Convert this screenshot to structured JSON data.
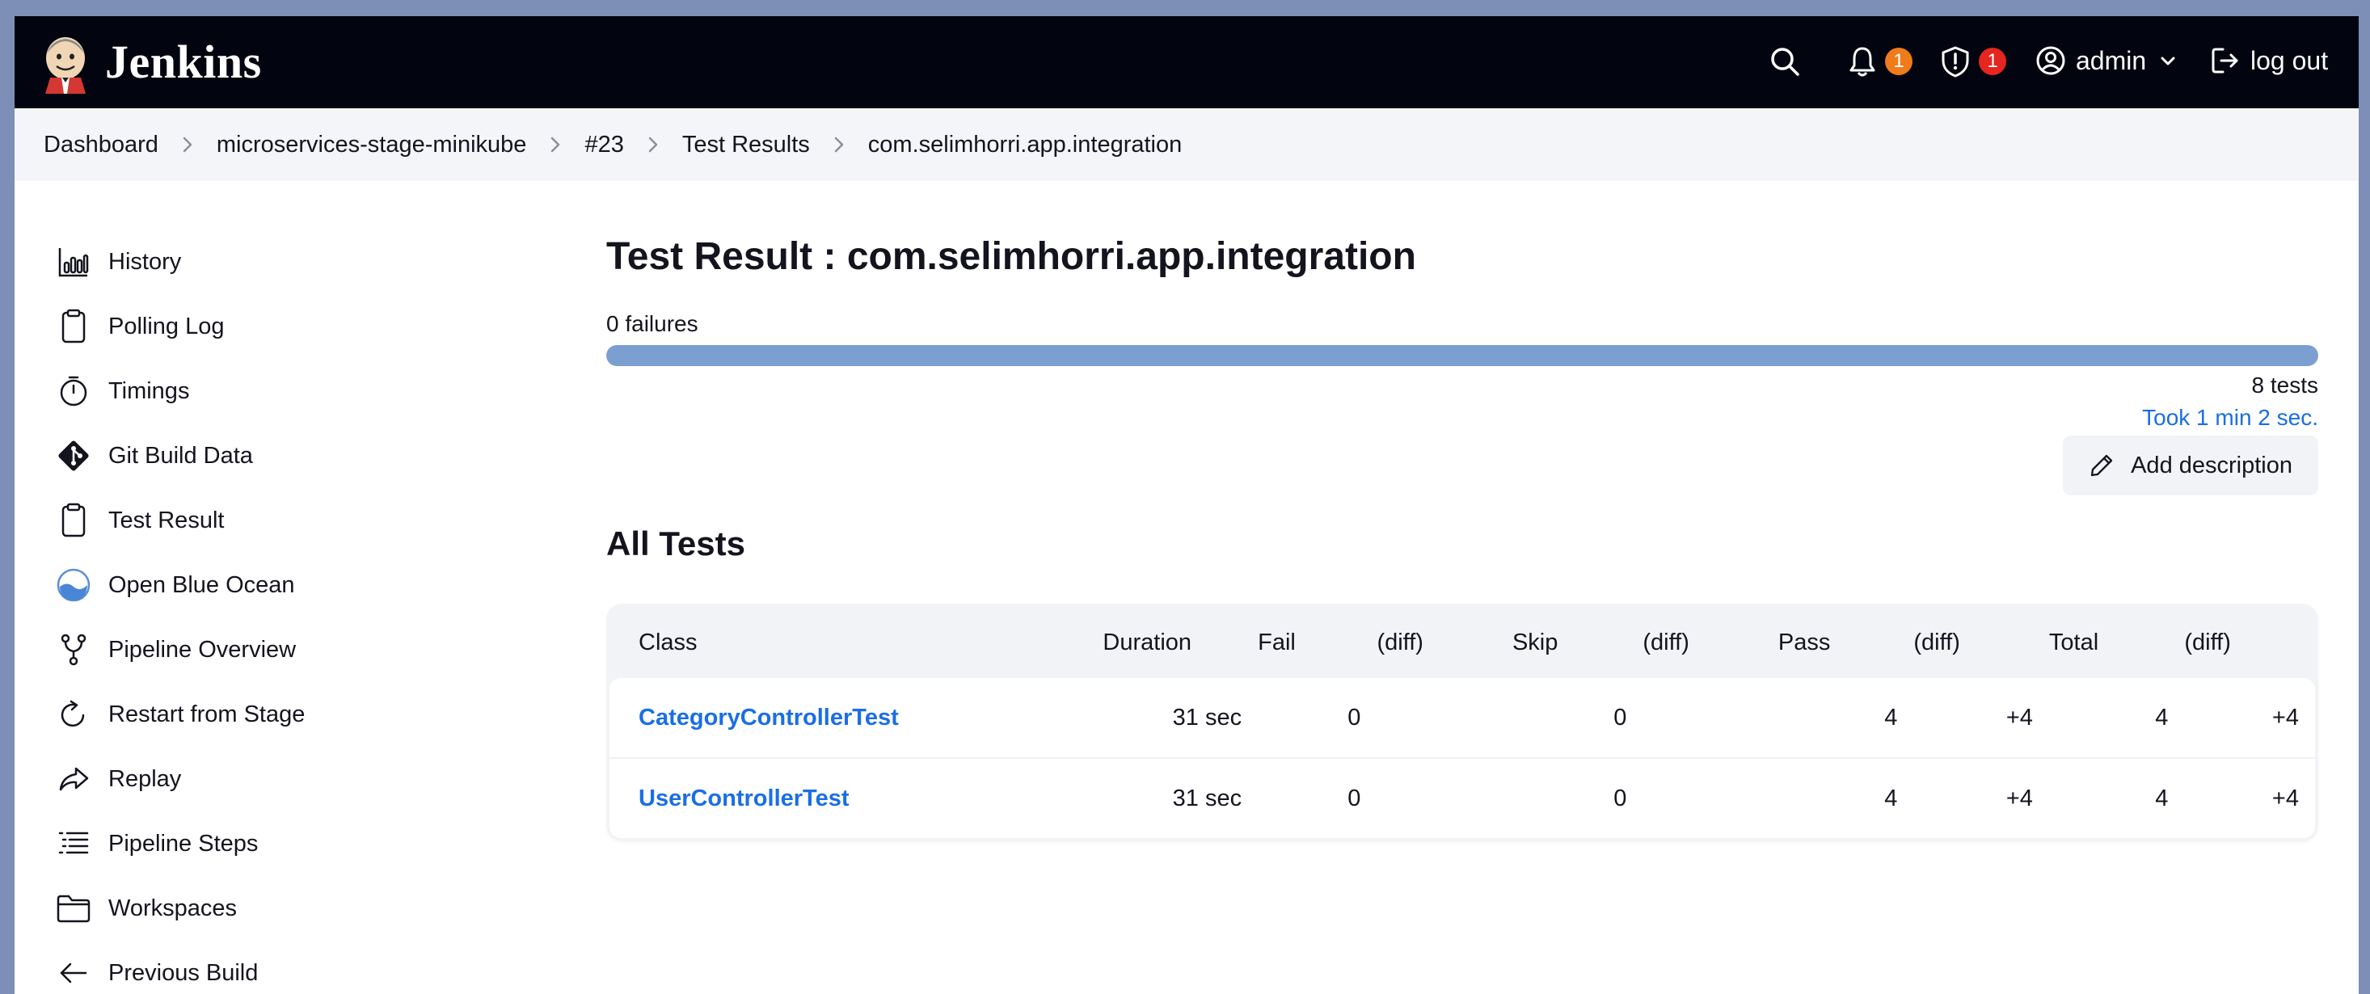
{
  "header": {
    "brand": "Jenkins",
    "notifications_count": "1",
    "security_count": "1",
    "user": "admin",
    "logout": "log out"
  },
  "breadcrumbs": [
    "Dashboard",
    "microservices-stage-minikube",
    "#23",
    "Test Results",
    "com.selimhorri.app.integration"
  ],
  "sidebar": {
    "items": [
      {
        "label": "History",
        "icon": "history-chart-icon"
      },
      {
        "label": "Polling Log",
        "icon": "clipboard-icon"
      },
      {
        "label": "Timings",
        "icon": "stopwatch-icon"
      },
      {
        "label": "Git Build Data",
        "icon": "git-icon"
      },
      {
        "label": "Test Result",
        "icon": "clipboard-icon"
      },
      {
        "label": "Open Blue Ocean",
        "icon": "blue-ocean-icon"
      },
      {
        "label": "Pipeline Overview",
        "icon": "pipeline-branch-icon"
      },
      {
        "label": "Restart from Stage",
        "icon": "restart-icon"
      },
      {
        "label": "Replay",
        "icon": "replay-arrow-icon"
      },
      {
        "label": "Pipeline Steps",
        "icon": "steps-list-icon"
      },
      {
        "label": "Workspaces",
        "icon": "folder-icon"
      },
      {
        "label": "Previous Build",
        "icon": "arrow-left-icon"
      }
    ]
  },
  "main": {
    "title": "Test Result : com.selimhorri.app.integration",
    "failures": "0 failures",
    "pass_ratio": 1.0,
    "tests": "8 tests",
    "took": "Took 1 min 2 sec.",
    "add_description": "Add description",
    "section_title": "All Tests"
  },
  "table": {
    "headers": [
      "Class",
      "Duration",
      "Fail",
      "(diff)",
      "Skip",
      "(diff)",
      "Pass",
      "(diff)",
      "Total",
      "(diff)"
    ],
    "rows": [
      [
        "CategoryControllerTest",
        "31 sec",
        "0",
        "",
        "0",
        "",
        "4",
        "+4",
        "4",
        "+4"
      ],
      [
        "UserControllerTest",
        "31 sec",
        "0",
        "",
        "0",
        "",
        "4",
        "+4",
        "4",
        "+4"
      ]
    ]
  },
  "colors": {
    "header_bg": "#02040f",
    "notification_badge": "#f07b1a",
    "security_badge": "#e5251f",
    "link": "#1a6ee6",
    "progress_pass": "#7b9fd1"
  }
}
